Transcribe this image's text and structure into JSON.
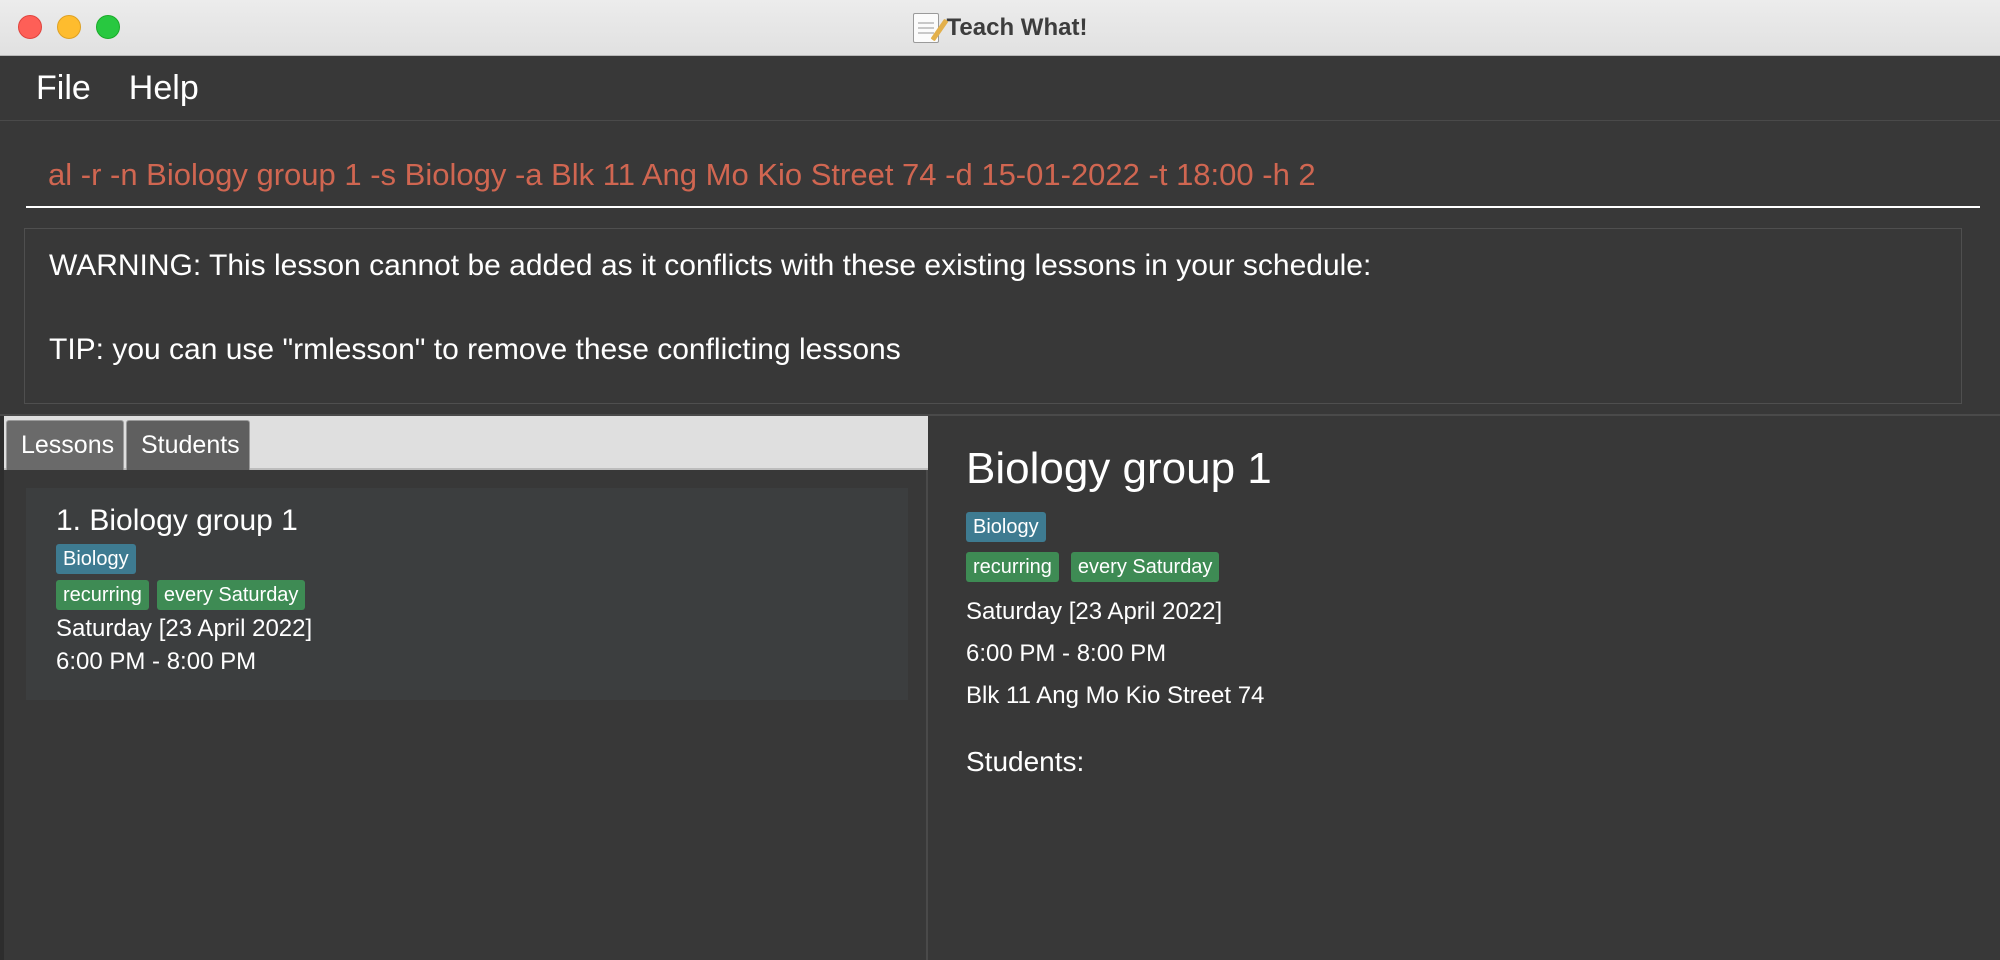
{
  "window": {
    "title": "Teach What!"
  },
  "menu": {
    "items": [
      "File",
      "Help"
    ]
  },
  "command": {
    "value": "al -r -n Biology group 1 -s Biology -a Blk 11 Ang Mo Kio Street 74 -d 15-01-2022 -t 18:00 -h 2",
    "text_color": "#d06651"
  },
  "result": {
    "warning": "WARNING: This lesson cannot be added as it conflicts with these existing lessons in your schedule:",
    "tip": "TIP: you can use \"rmlesson\" to remove these conflicting lessons"
  },
  "tabs": [
    {
      "label": "Lessons"
    },
    {
      "label": "Students"
    }
  ],
  "lessons": [
    {
      "index_title": "1.  Biology group 1",
      "subject": "Biology",
      "tags": [
        "recurring",
        "every Saturday"
      ],
      "date": "Saturday [23 April 2022]",
      "time": "6:00 PM - 8:00 PM"
    }
  ],
  "detail": {
    "title": "Biology group 1",
    "subject": "Biology",
    "tags": [
      "recurring",
      "every Saturday"
    ],
    "date": "Saturday [23 April 2022]",
    "time": "6:00 PM - 8:00 PM",
    "address": "Blk 11 Ang Mo Kio Street 74",
    "students_label": "Students:"
  },
  "colors": {
    "background": "#383838",
    "subject_tag": "#3e7b91",
    "green_tag": "#3e8b54"
  }
}
